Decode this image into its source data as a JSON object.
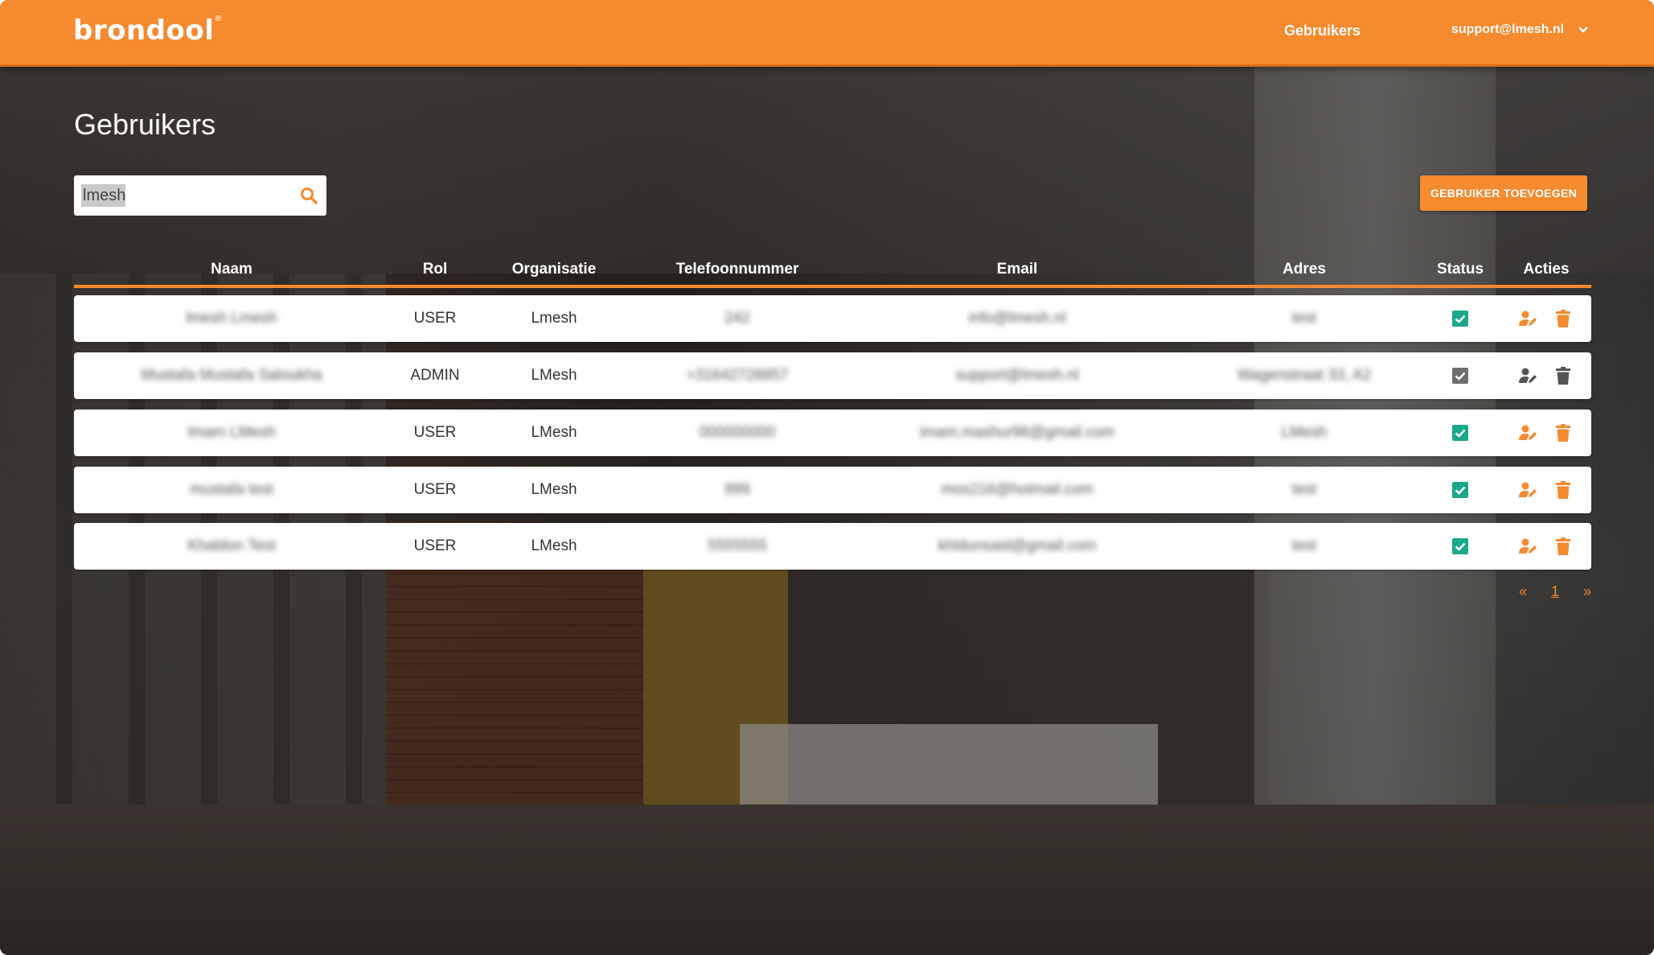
{
  "header": {
    "brand": "brondool",
    "brand_mark": "®",
    "nav_users": "Gebruikers",
    "account": "support@lmesh.nl"
  },
  "page": {
    "title": "Gebruikers",
    "search_value": "lmesh",
    "add_button": "GEBRUIKER TOEVOEGEN"
  },
  "table": {
    "columns": [
      "Naam",
      "Rol",
      "Organisatie",
      "Telefoonnummer",
      "Email",
      "Adres",
      "Status",
      "Acties"
    ],
    "rows": [
      {
        "naam": "lmesh Lmesh",
        "rol": "USER",
        "organisatie": "Lmesh",
        "telefoon": "242",
        "email": "info@lmesh.nl",
        "adres": "test",
        "status": "active"
      },
      {
        "naam": "Mustafa Mustafa Saloukha",
        "rol": "ADMIN",
        "organisatie": "LMesh",
        "telefoon": "+31642728857",
        "email": "support@lmesh.nl",
        "adres": "Wagenstraat 33, A2",
        "status": "self"
      },
      {
        "naam": "Imam LMesh",
        "rol": "USER",
        "organisatie": "LMesh",
        "telefoon": "000000000",
        "email": "imam.mashur96@gmail.com",
        "adres": "LMesh",
        "status": "active"
      },
      {
        "naam": "mustafa test",
        "rol": "USER",
        "organisatie": "LMesh",
        "telefoon": "999",
        "email": "mos216@hotmail.com",
        "adres": "test",
        "status": "active"
      },
      {
        "naam": "Khaldon Test",
        "rol": "USER",
        "organisatie": "LMesh",
        "telefoon": "5555555",
        "email": "khldunsaid@gmail.com",
        "adres": "test",
        "status": "active"
      }
    ]
  },
  "pagination": {
    "prev": "«",
    "current": "1",
    "next": "»"
  },
  "colors": {
    "accent": "#f58a2f",
    "status_active": "#1aa88a",
    "status_self": "#6e6e6e",
    "icon_disabled": "#555555"
  },
  "icons": [
    "search-icon",
    "chevron-down-icon",
    "checkbox-checked-icon",
    "user-edit-icon",
    "trash-icon"
  ]
}
